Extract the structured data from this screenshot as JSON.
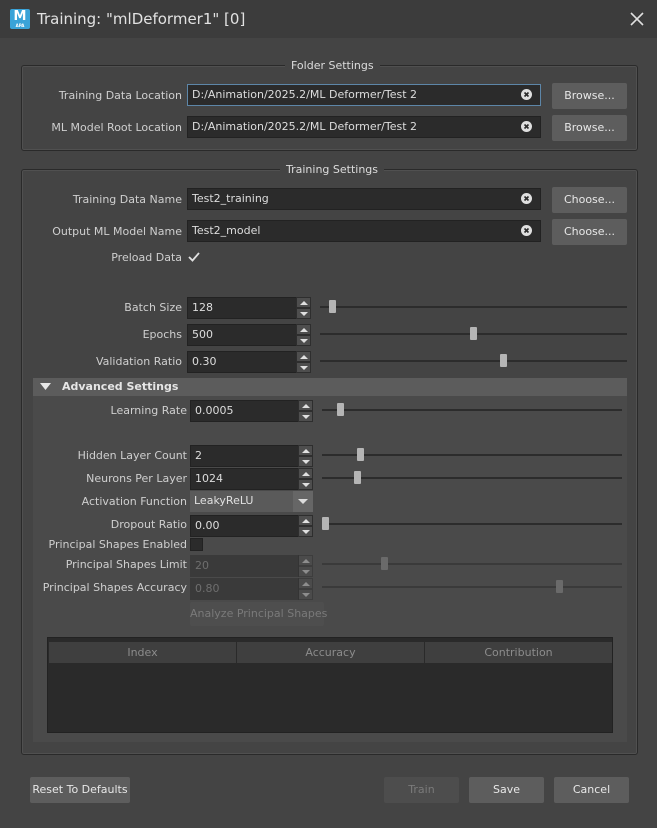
{
  "window": {
    "title": "Training: \"mlDeformer1\" [0]",
    "logo_letter": "M",
    "logo_sub": "APA"
  },
  "folder_settings": {
    "title": "Folder Settings",
    "training_data_location": {
      "label": "Training Data Location",
      "value": "D:/Animation/2025.2/ML Deformer/Test 2",
      "button": "Browse..."
    },
    "ml_model_root_location": {
      "label": "ML Model Root Location",
      "value": "D:/Animation/2025.2/ML Deformer/Test 2",
      "button": "Browse..."
    }
  },
  "training_settings": {
    "title": "Training Settings",
    "training_data_name": {
      "label": "Training Data Name",
      "value": "Test2_training",
      "button": "Choose..."
    },
    "output_ml_model_name": {
      "label": "Output ML Model Name",
      "value": "Test2_model",
      "button": "Choose..."
    },
    "preload_data": {
      "label": "Preload Data",
      "checked": true
    },
    "batch_size": {
      "label": "Batch Size",
      "value": "128",
      "slider_fraction": 0.03
    },
    "epochs": {
      "label": "Epochs",
      "value": "500",
      "slider_fraction": 0.5
    },
    "validation_ratio": {
      "label": "Validation Ratio",
      "value": "0.30",
      "slider_fraction": 0.6
    }
  },
  "advanced_settings": {
    "title": "Advanced Settings",
    "learning_rate": {
      "label": "Learning Rate",
      "value": "0.0005",
      "slider_fraction": 0.05
    },
    "hidden_layer_count": {
      "label": "Hidden Layer Count",
      "value": "2",
      "slider_fraction": 0.12
    },
    "neurons_per_layer": {
      "label": "Neurons Per Layer",
      "value": "1024",
      "slider_fraction": 0.11
    },
    "activation_function": {
      "label": "Activation Function",
      "value": "LeakyReLU"
    },
    "dropout_ratio": {
      "label": "Dropout Ratio",
      "value": "0.00",
      "slider_fraction": 0.0
    },
    "principal_shapes_enabled": {
      "label": "Principal Shapes Enabled",
      "checked": false
    },
    "principal_shapes_limit": {
      "label": "Principal Shapes Limit",
      "value": "20",
      "slider_fraction": 0.2
    },
    "principal_shapes_accuracy": {
      "label": "Principal Shapes Accuracy",
      "value": "0.80",
      "slider_fraction": 0.8
    },
    "analyze_button": "Analyze Principal Shapes",
    "table": {
      "columns": [
        "Index",
        "Accuracy",
        "Contribution"
      ],
      "rows": []
    }
  },
  "footer": {
    "reset": "Reset To Defaults",
    "train": "Train",
    "save": "Save",
    "cancel": "Cancel"
  },
  "colors": {
    "background": "#444444",
    "field": "#2b2b2b",
    "button": "#5d5d5d",
    "logo": "#3aa3d8",
    "focus": "#5d86a8"
  }
}
